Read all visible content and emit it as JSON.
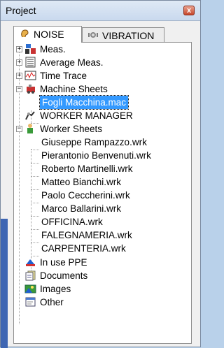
{
  "window": {
    "title": "Project",
    "close_glyph": "x"
  },
  "tabs": [
    {
      "label": "NOISE",
      "icon": "ear-icon",
      "active": true
    },
    {
      "label": "VIBRATION",
      "icon": "vibration-icon",
      "active": false
    }
  ],
  "tree": {
    "meas": "Meas.",
    "average_meas": "Average Meas.",
    "time_trace": "Time Trace",
    "machine_sheets": "Machine Sheets",
    "machine_file": "Fogli Macchina.mac",
    "worker_manager": "WORKER MANAGER",
    "worker_sheets": "Worker Sheets",
    "workers": [
      "Giuseppe Rampazzo.wrk",
      "Pierantonio Benvenuti.wrk",
      "Roberto Martinelli.wrk",
      "Matteo Bianchi.wrk",
      "Paolo Ceccherini.wrk",
      "Marco Ballarini.wrk",
      "OFFICINA.wrk",
      "FALEGNAMERIA.wrk",
      "CARPENTERIA.wrk"
    ],
    "in_use_ppe": "In use PPE",
    "documents": "Documents",
    "images": "Images",
    "other": "Other",
    "plus": "+",
    "minus": "−"
  },
  "colors": {
    "selection": "#3399ff",
    "close_button": "#c6462b"
  }
}
